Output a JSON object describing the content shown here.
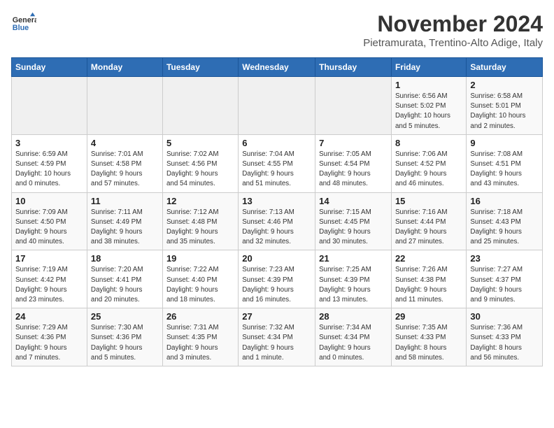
{
  "header": {
    "logo_line1": "General",
    "logo_line2": "Blue",
    "month": "November 2024",
    "location": "Pietramurata, Trentino-Alto Adige, Italy"
  },
  "weekdays": [
    "Sunday",
    "Monday",
    "Tuesday",
    "Wednesday",
    "Thursday",
    "Friday",
    "Saturday"
  ],
  "weeks": [
    [
      {
        "day": "",
        "info": ""
      },
      {
        "day": "",
        "info": ""
      },
      {
        "day": "",
        "info": ""
      },
      {
        "day": "",
        "info": ""
      },
      {
        "day": "",
        "info": ""
      },
      {
        "day": "1",
        "info": "Sunrise: 6:56 AM\nSunset: 5:02 PM\nDaylight: 10 hours\nand 5 minutes."
      },
      {
        "day": "2",
        "info": "Sunrise: 6:58 AM\nSunset: 5:01 PM\nDaylight: 10 hours\nand 2 minutes."
      }
    ],
    [
      {
        "day": "3",
        "info": "Sunrise: 6:59 AM\nSunset: 4:59 PM\nDaylight: 10 hours\nand 0 minutes."
      },
      {
        "day": "4",
        "info": "Sunrise: 7:01 AM\nSunset: 4:58 PM\nDaylight: 9 hours\nand 57 minutes."
      },
      {
        "day": "5",
        "info": "Sunrise: 7:02 AM\nSunset: 4:56 PM\nDaylight: 9 hours\nand 54 minutes."
      },
      {
        "day": "6",
        "info": "Sunrise: 7:04 AM\nSunset: 4:55 PM\nDaylight: 9 hours\nand 51 minutes."
      },
      {
        "day": "7",
        "info": "Sunrise: 7:05 AM\nSunset: 4:54 PM\nDaylight: 9 hours\nand 48 minutes."
      },
      {
        "day": "8",
        "info": "Sunrise: 7:06 AM\nSunset: 4:52 PM\nDaylight: 9 hours\nand 46 minutes."
      },
      {
        "day": "9",
        "info": "Sunrise: 7:08 AM\nSunset: 4:51 PM\nDaylight: 9 hours\nand 43 minutes."
      }
    ],
    [
      {
        "day": "10",
        "info": "Sunrise: 7:09 AM\nSunset: 4:50 PM\nDaylight: 9 hours\nand 40 minutes."
      },
      {
        "day": "11",
        "info": "Sunrise: 7:11 AM\nSunset: 4:49 PM\nDaylight: 9 hours\nand 38 minutes."
      },
      {
        "day": "12",
        "info": "Sunrise: 7:12 AM\nSunset: 4:48 PM\nDaylight: 9 hours\nand 35 minutes."
      },
      {
        "day": "13",
        "info": "Sunrise: 7:13 AM\nSunset: 4:46 PM\nDaylight: 9 hours\nand 32 minutes."
      },
      {
        "day": "14",
        "info": "Sunrise: 7:15 AM\nSunset: 4:45 PM\nDaylight: 9 hours\nand 30 minutes."
      },
      {
        "day": "15",
        "info": "Sunrise: 7:16 AM\nSunset: 4:44 PM\nDaylight: 9 hours\nand 27 minutes."
      },
      {
        "day": "16",
        "info": "Sunrise: 7:18 AM\nSunset: 4:43 PM\nDaylight: 9 hours\nand 25 minutes."
      }
    ],
    [
      {
        "day": "17",
        "info": "Sunrise: 7:19 AM\nSunset: 4:42 PM\nDaylight: 9 hours\nand 23 minutes."
      },
      {
        "day": "18",
        "info": "Sunrise: 7:20 AM\nSunset: 4:41 PM\nDaylight: 9 hours\nand 20 minutes."
      },
      {
        "day": "19",
        "info": "Sunrise: 7:22 AM\nSunset: 4:40 PM\nDaylight: 9 hours\nand 18 minutes."
      },
      {
        "day": "20",
        "info": "Sunrise: 7:23 AM\nSunset: 4:39 PM\nDaylight: 9 hours\nand 16 minutes."
      },
      {
        "day": "21",
        "info": "Sunrise: 7:25 AM\nSunset: 4:39 PM\nDaylight: 9 hours\nand 13 minutes."
      },
      {
        "day": "22",
        "info": "Sunrise: 7:26 AM\nSunset: 4:38 PM\nDaylight: 9 hours\nand 11 minutes."
      },
      {
        "day": "23",
        "info": "Sunrise: 7:27 AM\nSunset: 4:37 PM\nDaylight: 9 hours\nand 9 minutes."
      }
    ],
    [
      {
        "day": "24",
        "info": "Sunrise: 7:29 AM\nSunset: 4:36 PM\nDaylight: 9 hours\nand 7 minutes."
      },
      {
        "day": "25",
        "info": "Sunrise: 7:30 AM\nSunset: 4:36 PM\nDaylight: 9 hours\nand 5 minutes."
      },
      {
        "day": "26",
        "info": "Sunrise: 7:31 AM\nSunset: 4:35 PM\nDaylight: 9 hours\nand 3 minutes."
      },
      {
        "day": "27",
        "info": "Sunrise: 7:32 AM\nSunset: 4:34 PM\nDaylight: 9 hours\nand 1 minute."
      },
      {
        "day": "28",
        "info": "Sunrise: 7:34 AM\nSunset: 4:34 PM\nDaylight: 9 hours\nand 0 minutes."
      },
      {
        "day": "29",
        "info": "Sunrise: 7:35 AM\nSunset: 4:33 PM\nDaylight: 8 hours\nand 58 minutes."
      },
      {
        "day": "30",
        "info": "Sunrise: 7:36 AM\nSunset: 4:33 PM\nDaylight: 8 hours\nand 56 minutes."
      }
    ]
  ]
}
